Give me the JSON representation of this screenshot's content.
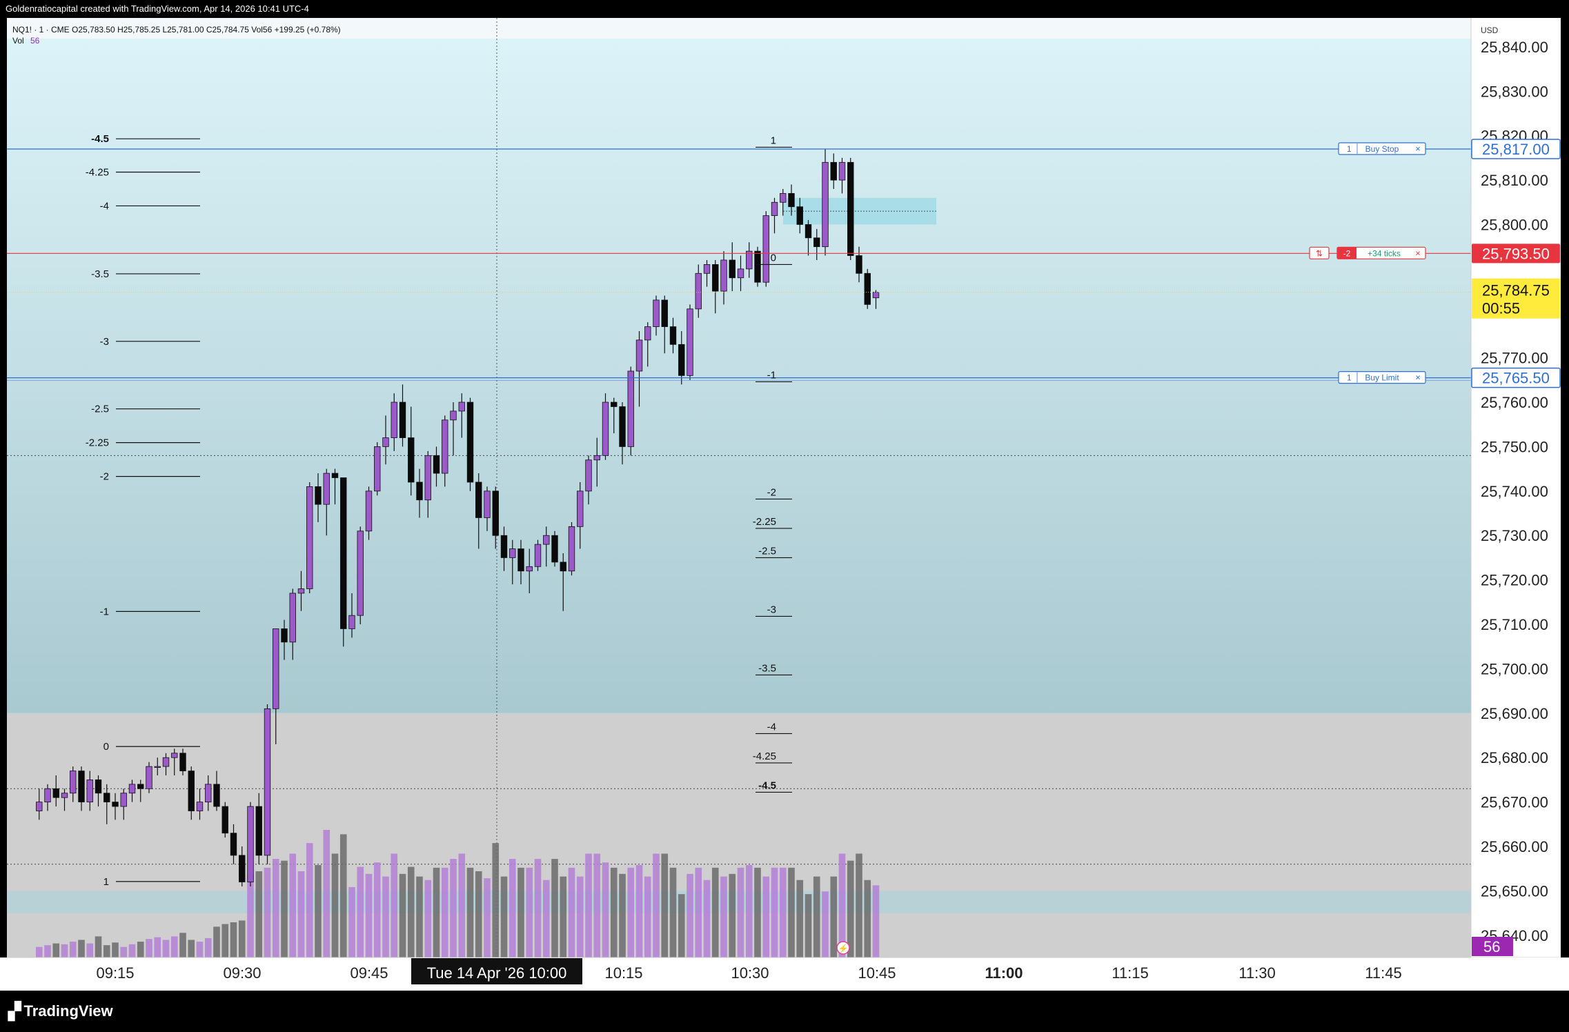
{
  "header": {
    "credit": "Goldenratiocapital created with TradingView.com, Apr 14, 2026 10:41 UTC-4"
  },
  "legend": {
    "symbol": "NQ1! · 1 · CME",
    "open": "O25,783.50",
    "high": "H25,785.25",
    "low": "L25,781.00",
    "close": "C25,784.75",
    "volume": "Vol56",
    "change": "+199.25 (+0.78%)",
    "vol_label": "Vol",
    "vol_value": "56"
  },
  "footer": {
    "logo": "TradingView"
  },
  "colors": {
    "bull": "#9b59c9",
    "bear": "#0a0a0a",
    "upper_bg": "#c9e7ee",
    "lower_bg": "#cfcfcf",
    "buy_line": "#2d6fd6",
    "position_line": "#e8343f",
    "last_price_bg": "#ffeb3b",
    "vol_bull": "#b47fd6",
    "vol_bear": "#6b6b6b"
  },
  "chart_data": {
    "type": "candlestick",
    "symbol": "NQ1!",
    "timeframe": "1",
    "exchange": "CME",
    "currency": "USD",
    "x_ticks": [
      "09:15",
      "09:30",
      "09:45",
      "10:15",
      "10:30",
      "10:45",
      "11:00",
      "11:15",
      "11:30",
      "11:45"
    ],
    "crosshair_time_label": "Tue 14 Apr '26   10:00",
    "y_ticks": [
      "25,640.00",
      "25,650.00",
      "25,660.00",
      "25,670.00",
      "25,680.00",
      "25,690.00",
      "25,700.00",
      "25,710.00",
      "25,720.00",
      "25,730.00",
      "25,740.00",
      "25,750.00",
      "25,760.00",
      "25,770.00",
      "25,800.00",
      "25,810.00",
      "25,820.00",
      "25,830.00",
      "25,840.00"
    ],
    "ylim": [
      25635,
      25842
    ],
    "price_labels": {
      "buy_stop_price": "25,817.00",
      "position_price": "25,793.50",
      "last_price": "25,784.75",
      "countdown": "00:55",
      "buy_limit_price": "25,765.50",
      "volume_badge": "56"
    },
    "orders": {
      "buy_stop": {
        "qty": "1",
        "label": "Buy Stop",
        "close": "×"
      },
      "position": {
        "icon": "⇅",
        "qty": "-2",
        "label": "+34 ticks",
        "close": "×"
      },
      "buy_limit": {
        "qty": "1",
        "label": "Buy Limit",
        "close": "×"
      }
    },
    "fib_left": {
      "levels": [
        "-4.5",
        "-4.25",
        "-4",
        "-3.5",
        "-3",
        "-2.5",
        "-2.25",
        "-2",
        "-1",
        "0",
        "1"
      ],
      "prices": [
        25819.3,
        25811.8,
        25804.2,
        25788.9,
        25773.7,
        25758.5,
        25750.9,
        25743.3,
        25712.9,
        25682.5,
        25652.1
      ]
    },
    "fib_right": {
      "levels": [
        "1",
        "0",
        "-1",
        "-2",
        "-2.25",
        "-2.5",
        "-3",
        "-3.5",
        "-4",
        "-4.25",
        "-4.5"
      ],
      "prices": [
        25817.4,
        25791.0,
        25764.6,
        25738.2,
        25731.6,
        25725.0,
        25711.8,
        25698.6,
        25685.4,
        25678.8,
        25672.2
      ]
    },
    "candles": [
      {
        "o": 25668,
        "h": 25673,
        "l": 25666,
        "c": 25670
      },
      {
        "o": 25670,
        "h": 25674,
        "l": 25668,
        "c": 25673
      },
      {
        "o": 25673,
        "h": 25676,
        "l": 25669,
        "c": 25671
      },
      {
        "o": 25671,
        "h": 25673,
        "l": 25668,
        "c": 25672
      },
      {
        "o": 25672,
        "h": 25678,
        "l": 25670,
        "c": 25677
      },
      {
        "o": 25677,
        "h": 25678,
        "l": 25668,
        "c": 25670
      },
      {
        "o": 25670,
        "h": 25677,
        "l": 25668,
        "c": 25675
      },
      {
        "o": 25675,
        "h": 25676,
        "l": 25669,
        "c": 25672
      },
      {
        "o": 25672,
        "h": 25674,
        "l": 25665,
        "c": 25670
      },
      {
        "o": 25670,
        "h": 25672,
        "l": 25666,
        "c": 25669
      },
      {
        "o": 25669,
        "h": 25673,
        "l": 25666,
        "c": 25672
      },
      {
        "o": 25672,
        "h": 25675,
        "l": 25670,
        "c": 25674
      },
      {
        "o": 25674,
        "h": 25675,
        "l": 25670,
        "c": 25673
      },
      {
        "o": 25673,
        "h": 25679,
        "l": 25672,
        "c": 25678
      },
      {
        "o": 25678,
        "h": 25680,
        "l": 25676,
        "c": 25678
      },
      {
        "o": 25678,
        "h": 25681,
        "l": 25676,
        "c": 25680
      },
      {
        "o": 25680,
        "h": 25682,
        "l": 25676,
        "c": 25681
      },
      {
        "o": 25681,
        "h": 25682,
        "l": 25676,
        "c": 25677
      },
      {
        "o": 25677,
        "h": 25678,
        "l": 25666,
        "c": 25668
      },
      {
        "o": 25668,
        "h": 25673,
        "l": 25666,
        "c": 25670
      },
      {
        "o": 25670,
        "h": 25676,
        "l": 25668,
        "c": 25674
      },
      {
        "o": 25674,
        "h": 25677,
        "l": 25668,
        "c": 25669
      },
      {
        "o": 25669,
        "h": 25670,
        "l": 25662,
        "c": 25663
      },
      {
        "o": 25663,
        "h": 25665,
        "l": 25656,
        "c": 25658
      },
      {
        "o": 25658,
        "h": 25660,
        "l": 25651,
        "c": 25652
      },
      {
        "o": 25652,
        "h": 25670,
        "l": 25651,
        "c": 25669
      },
      {
        "o": 25669,
        "h": 25672,
        "l": 25656,
        "c": 25658
      },
      {
        "o": 25658,
        "h": 25692,
        "l": 25656,
        "c": 25691
      },
      {
        "o": 25691,
        "h": 25709,
        "l": 25683,
        "c": 25709
      },
      {
        "o": 25709,
        "h": 25711,
        "l": 25702,
        "c": 25706
      },
      {
        "o": 25706,
        "h": 25718,
        "l": 25702,
        "c": 25717
      },
      {
        "o": 25717,
        "h": 25722,
        "l": 25713,
        "c": 25718
      },
      {
        "o": 25718,
        "h": 25742,
        "l": 25717,
        "c": 25741
      },
      {
        "o": 25741,
        "h": 25744,
        "l": 25733,
        "c": 25737
      },
      {
        "o": 25737,
        "h": 25745,
        "l": 25730,
        "c": 25744
      },
      {
        "o": 25744,
        "h": 25745,
        "l": 25737,
        "c": 25743
      },
      {
        "o": 25743,
        "h": 25743,
        "l": 25705,
        "c": 25709
      },
      {
        "o": 25709,
        "h": 25717,
        "l": 25707,
        "c": 25712
      },
      {
        "o": 25712,
        "h": 25732,
        "l": 25710,
        "c": 25731
      },
      {
        "o": 25731,
        "h": 25741,
        "l": 25729,
        "c": 25740
      },
      {
        "o": 25740,
        "h": 25751,
        "l": 25739,
        "c": 25750
      },
      {
        "o": 25750,
        "h": 25757,
        "l": 25746,
        "c": 25752
      },
      {
        "o": 25752,
        "h": 25762,
        "l": 25749,
        "c": 25760
      },
      {
        "o": 25760,
        "h": 25764,
        "l": 25750,
        "c": 25752
      },
      {
        "o": 25752,
        "h": 25759,
        "l": 25739,
        "c": 25742
      },
      {
        "o": 25742,
        "h": 25745,
        "l": 25734,
        "c": 25738
      },
      {
        "o": 25738,
        "h": 25749,
        "l": 25734,
        "c": 25748
      },
      {
        "o": 25748,
        "h": 25750,
        "l": 25741,
        "c": 25744
      },
      {
        "o": 25744,
        "h": 25757,
        "l": 25741,
        "c": 25756
      },
      {
        "o": 25756,
        "h": 25760,
        "l": 25748,
        "c": 25758
      },
      {
        "o": 25758,
        "h": 25762,
        "l": 25752,
        "c": 25760
      },
      {
        "o": 25760,
        "h": 25761,
        "l": 25740,
        "c": 25742
      },
      {
        "o": 25742,
        "h": 25744,
        "l": 25727,
        "c": 25734
      },
      {
        "o": 25734,
        "h": 25741,
        "l": 25731,
        "c": 25740
      },
      {
        "o": 25740,
        "h": 25741,
        "l": 25727,
        "c": 25730
      },
      {
        "o": 25730,
        "h": 25732,
        "l": 25722,
        "c": 25725
      },
      {
        "o": 25725,
        "h": 25729,
        "l": 25719,
        "c": 25727
      },
      {
        "o": 25727,
        "h": 25729,
        "l": 25719,
        "c": 25722
      },
      {
        "o": 25722,
        "h": 25727,
        "l": 25717,
        "c": 25723
      },
      {
        "o": 25723,
        "h": 25729,
        "l": 25722,
        "c": 25728
      },
      {
        "o": 25728,
        "h": 25732,
        "l": 25723,
        "c": 25730
      },
      {
        "o": 25730,
        "h": 25731,
        "l": 25723,
        "c": 25724
      },
      {
        "o": 25724,
        "h": 25726,
        "l": 25713,
        "c": 25722
      },
      {
        "o": 25722,
        "h": 25733,
        "l": 25721,
        "c": 25732
      },
      {
        "o": 25732,
        "h": 25742,
        "l": 25727,
        "c": 25740
      },
      {
        "o": 25740,
        "h": 25748,
        "l": 25737,
        "c": 25747
      },
      {
        "o": 25747,
        "h": 25752,
        "l": 25741,
        "c": 25748
      },
      {
        "o": 25748,
        "h": 25762,
        "l": 25747,
        "c": 25760
      },
      {
        "o": 25760,
        "h": 25761,
        "l": 25753,
        "c": 25759
      },
      {
        "o": 25759,
        "h": 25760,
        "l": 25746,
        "c": 25750
      },
      {
        "o": 25750,
        "h": 25768,
        "l": 25748,
        "c": 25767
      },
      {
        "o": 25767,
        "h": 25776,
        "l": 25759,
        "c": 25774
      },
      {
        "o": 25774,
        "h": 25778,
        "l": 25768,
        "c": 25777
      },
      {
        "o": 25777,
        "h": 25784,
        "l": 25775,
        "c": 25783
      },
      {
        "o": 25783,
        "h": 25784,
        "l": 25771,
        "c": 25777
      },
      {
        "o": 25777,
        "h": 25779,
        "l": 25771,
        "c": 25773
      },
      {
        "o": 25773,
        "h": 25776,
        "l": 25764,
        "c": 25766
      },
      {
        "o": 25766,
        "h": 25782,
        "l": 25765,
        "c": 25781
      },
      {
        "o": 25781,
        "h": 25791,
        "l": 25779,
        "c": 25789
      },
      {
        "o": 25789,
        "h": 25792,
        "l": 25786,
        "c": 25791
      },
      {
        "o": 25791,
        "h": 25792,
        "l": 25780,
        "c": 25785
      },
      {
        "o": 25785,
        "h": 25794,
        "l": 25782,
        "c": 25792
      },
      {
        "o": 25792,
        "h": 25796,
        "l": 25785,
        "c": 25788
      },
      {
        "o": 25788,
        "h": 25793,
        "l": 25785,
        "c": 25790
      },
      {
        "o": 25790,
        "h": 25796,
        "l": 25788,
        "c": 25794
      },
      {
        "o": 25794,
        "h": 25795,
        "l": 25786,
        "c": 25787
      },
      {
        "o": 25787,
        "h": 25803,
        "l": 25786,
        "c": 25802
      },
      {
        "o": 25802,
        "h": 25806,
        "l": 25798,
        "c": 25805
      },
      {
        "o": 25805,
        "h": 25808,
        "l": 25802,
        "c": 25807
      },
      {
        "o": 25807,
        "h": 25809,
        "l": 25802,
        "c": 25804
      },
      {
        "o": 25804,
        "h": 25806,
        "l": 25798,
        "c": 25800
      },
      {
        "o": 25800,
        "h": 25801,
        "l": 25793,
        "c": 25797
      },
      {
        "o": 25797,
        "h": 25799,
        "l": 25792,
        "c": 25795
      },
      {
        "o": 25795,
        "h": 25817,
        "l": 25793,
        "c": 25814
      },
      {
        "o": 25814,
        "h": 25816,
        "l": 25808,
        "c": 25810
      },
      {
        "o": 25810,
        "h": 25815,
        "l": 25807,
        "c": 25814
      },
      {
        "o": 25814,
        "h": 25815,
        "l": 25792,
        "c": 25793
      },
      {
        "o": 25793,
        "h": 25795,
        "l": 25787,
        "c": 25789
      },
      {
        "o": 25789,
        "h": 25790,
        "l": 25781,
        "c": 25782
      },
      {
        "o": 25783.5,
        "h": 25785.25,
        "l": 25781,
        "c": 25784.75
      }
    ],
    "volume": [
      12,
      14,
      16,
      15,
      18,
      20,
      16,
      24,
      14,
      17,
      12,
      15,
      18,
      21,
      23,
      20,
      24,
      28,
      20,
      18,
      22,
      35,
      38,
      40,
      42,
      95,
      98,
      102,
      112,
      110,
      118,
      98,
      130,
      105,
      145,
      118,
      140,
      80,
      103,
      95,
      108,
      92,
      118,
      95,
      103,
      92,
      88,
      102,
      102,
      112,
      118,
      102,
      98,
      90,
      130,
      92,
      112,
      102,
      102,
      112,
      88,
      112,
      92,
      102,
      92,
      118,
      118,
      108,
      102,
      95,
      102,
      105,
      92,
      118,
      118,
      102,
      72,
      95,
      102,
      88,
      102,
      92,
      95,
      102,
      105,
      102,
      92,
      102,
      102,
      102,
      88,
      72,
      92,
      75,
      92,
      118,
      110,
      118,
      88,
      82
    ]
  }
}
